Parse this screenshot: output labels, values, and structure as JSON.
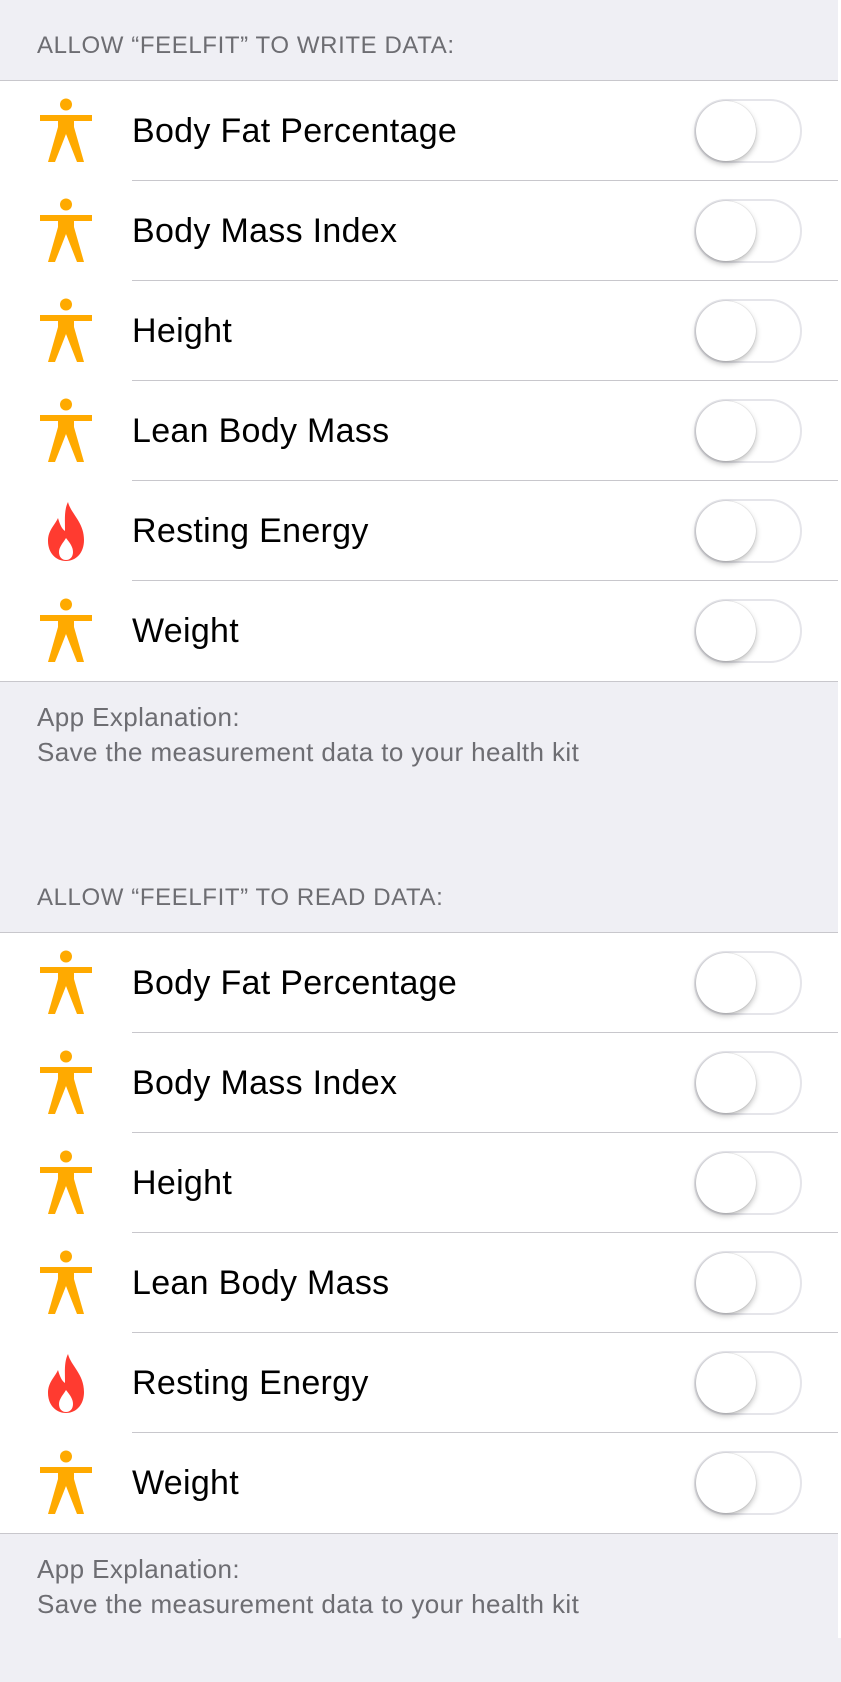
{
  "write_section": {
    "header": "ALLOW “FEELFIT” TO WRITE DATA:",
    "items": [
      {
        "label": "Body Fat Percentage",
        "icon": "body-figure-icon",
        "enabled": false
      },
      {
        "label": "Body Mass Index",
        "icon": "body-figure-icon",
        "enabled": false
      },
      {
        "label": "Height",
        "icon": "body-figure-icon",
        "enabled": false
      },
      {
        "label": "Lean Body Mass",
        "icon": "body-figure-icon",
        "enabled": false
      },
      {
        "label": "Resting Energy",
        "icon": "flame-icon",
        "enabled": false
      },
      {
        "label": "Weight",
        "icon": "body-figure-icon",
        "enabled": false
      }
    ],
    "footer_title": "App Explanation:",
    "footer_text": "Save the measurement data to your health kit"
  },
  "read_section": {
    "header": "ALLOW “FEELFIT” TO READ DATA:",
    "items": [
      {
        "label": "Body Fat Percentage",
        "icon": "body-figure-icon",
        "enabled": false
      },
      {
        "label": "Body Mass Index",
        "icon": "body-figure-icon",
        "enabled": false
      },
      {
        "label": "Height",
        "icon": "body-figure-icon",
        "enabled": false
      },
      {
        "label": "Lean Body Mass",
        "icon": "body-figure-icon",
        "enabled": false
      },
      {
        "label": "Resting Energy",
        "icon": "flame-icon",
        "enabled": false
      },
      {
        "label": "Weight",
        "icon": "body-figure-icon",
        "enabled": false
      }
    ],
    "footer_title": "App Explanation:",
    "footer_text": "Save the measurement data to your health kit"
  },
  "colors": {
    "body_icon": "#FFAA00",
    "flame_icon": "#FF3B30",
    "background": "#EFEFF4",
    "secondary_text": "#6D6D72"
  }
}
